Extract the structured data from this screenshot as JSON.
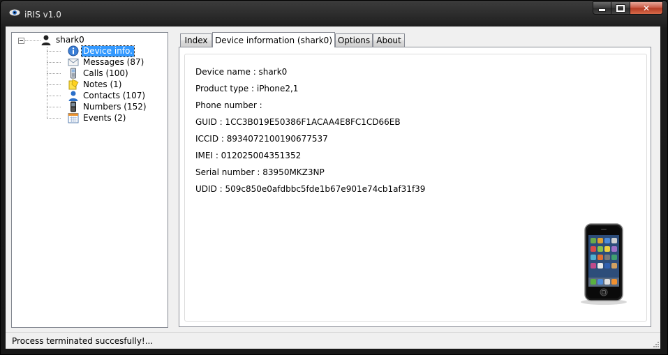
{
  "window": {
    "title": "iRIS v1.0"
  },
  "tree": {
    "root": "shark0",
    "items": [
      {
        "label": "Device info.",
        "icon": "info-icon",
        "selected": true
      },
      {
        "label": "Messages (87)",
        "icon": "envelope-icon"
      },
      {
        "label": "Calls (100)",
        "icon": "phone-icon"
      },
      {
        "label": "Notes (1)",
        "icon": "notes-icon"
      },
      {
        "label": "Contacts (107)",
        "icon": "contact-icon"
      },
      {
        "label": "Numbers (152)",
        "icon": "cellphone-icon"
      },
      {
        "label": "Events (2)",
        "icon": "calendar-icon"
      }
    ]
  },
  "tabs": [
    {
      "label": "Index"
    },
    {
      "label": "Device information (shark0)",
      "active": true
    },
    {
      "label": "Options"
    },
    {
      "label": "About"
    }
  ],
  "device_info": {
    "device_name": "Device name : shark0",
    "product_type": "Product type :  iPhone2,1",
    "phone_number": "Phone number :",
    "guid": "GUID :  1CC3B019E50386F1ACAA4E8FC1CD66EB",
    "iccid": "ICCID :  8934072100190677537",
    "imei": "IMEI : 012025004351352",
    "serial": "Serial number :  83950MKZ3NP",
    "udid": "UDID :  509c850e0afdbbc5fde1b67e901e74cb1af31f39"
  },
  "status": {
    "text": "Process terminated succesfully!..."
  },
  "colors": {
    "selection": "#3399ff",
    "close_button": "#c8543f"
  }
}
